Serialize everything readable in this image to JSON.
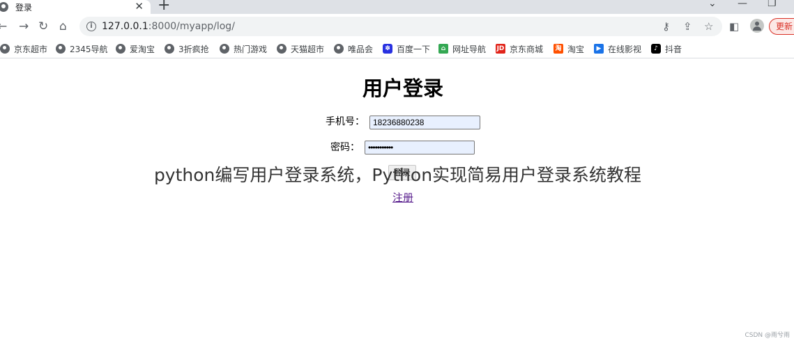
{
  "browser": {
    "tab": {
      "title": "登录",
      "close": "✕"
    },
    "new_tab": "+",
    "window_controls": {
      "chevron": "⌄",
      "minimize": "—",
      "restore": "❐"
    },
    "nav": {
      "back": "←",
      "forward": "→",
      "reload": "↻",
      "home": "⌂"
    },
    "address": {
      "host": "127.0.0.1",
      "rest": ":8000/myapp/log/"
    },
    "omnibox_icons": [
      "key-icon",
      "share-icon",
      "star-icon"
    ],
    "toolbar_icons": [
      "side-panel-icon",
      "profile-icon"
    ],
    "update_label": "更新",
    "bookmarks": [
      {
        "label": "京东超市",
        "icon": "globe"
      },
      {
        "label": "2345导航",
        "icon": "globe"
      },
      {
        "label": "爱淘宝",
        "icon": "globe"
      },
      {
        "label": "3折疯抢",
        "icon": "globe"
      },
      {
        "label": "热门游戏",
        "icon": "globe"
      },
      {
        "label": "天猫超市",
        "icon": "globe"
      },
      {
        "label": "唯品会",
        "icon": "globe"
      },
      {
        "label": "百度一下",
        "icon": "paw"
      },
      {
        "label": "网址导航",
        "icon": "house"
      },
      {
        "label": "京东商城",
        "icon": "jd"
      },
      {
        "label": "淘宝",
        "icon": "taobao"
      },
      {
        "label": "在线影视",
        "icon": "film"
      },
      {
        "label": "抖音",
        "icon": "tiktok"
      }
    ],
    "bookmark_icon_text": {
      "jd": "JD",
      "taobao": "淘"
    }
  },
  "page": {
    "title": "用户登录",
    "phone_label": "手机号：",
    "phone_value": "18236880238",
    "password_label": "密码：",
    "password_mask": "•••••••••••",
    "login_button": "登录",
    "register_link": "注册"
  },
  "overlay_caption": "python编写用户登录系统，Python实现简易用户登录系统教程",
  "watermark": "CSDN @雨兮雨"
}
